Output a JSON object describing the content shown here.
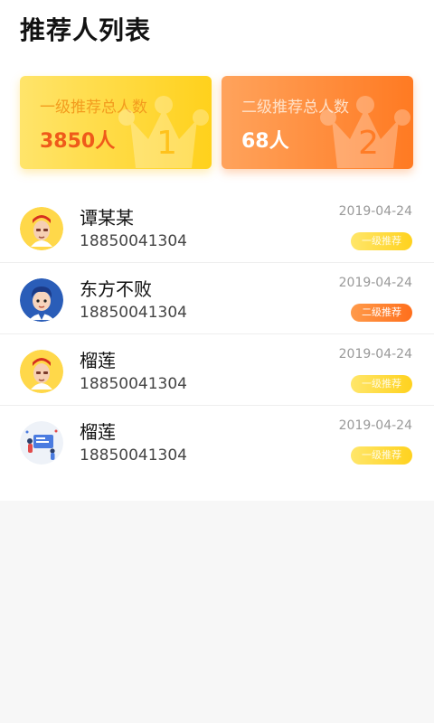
{
  "page": {
    "title": "推荐人列表"
  },
  "summary": {
    "level1": {
      "label": "一级推荐总人数",
      "value": "3850人",
      "crown_number": "1"
    },
    "level2": {
      "label": "二级推荐总人数",
      "value": "68人",
      "crown_number": "2"
    }
  },
  "referrers": [
    {
      "name": "谭某某",
      "phone": "18850041304",
      "date": "2019-04-24",
      "badge": "一级推荐",
      "level": "1",
      "avatar": "cartoon-man-yellow-avatar"
    },
    {
      "name": "东方不败",
      "phone": "18850041304",
      "date": "2019-04-24",
      "badge": "二级推荐",
      "level": "2",
      "avatar": "cartoon-boy-blue-avatar"
    },
    {
      "name": "榴莲",
      "phone": "18850041304",
      "date": "2019-04-24",
      "badge": "一级推荐",
      "level": "1",
      "avatar": "cartoon-man-yellow-avatar"
    },
    {
      "name": "榴莲",
      "phone": "18850041304",
      "date": "2019-04-24",
      "badge": "一级推荐",
      "level": "1",
      "avatar": "people-illustration-avatar"
    }
  ],
  "colors": {
    "level1_start": "#ffe46a",
    "level1_end": "#ffd11c",
    "level2_start": "#ffa35c",
    "level2_end": "#ff7a22"
  }
}
